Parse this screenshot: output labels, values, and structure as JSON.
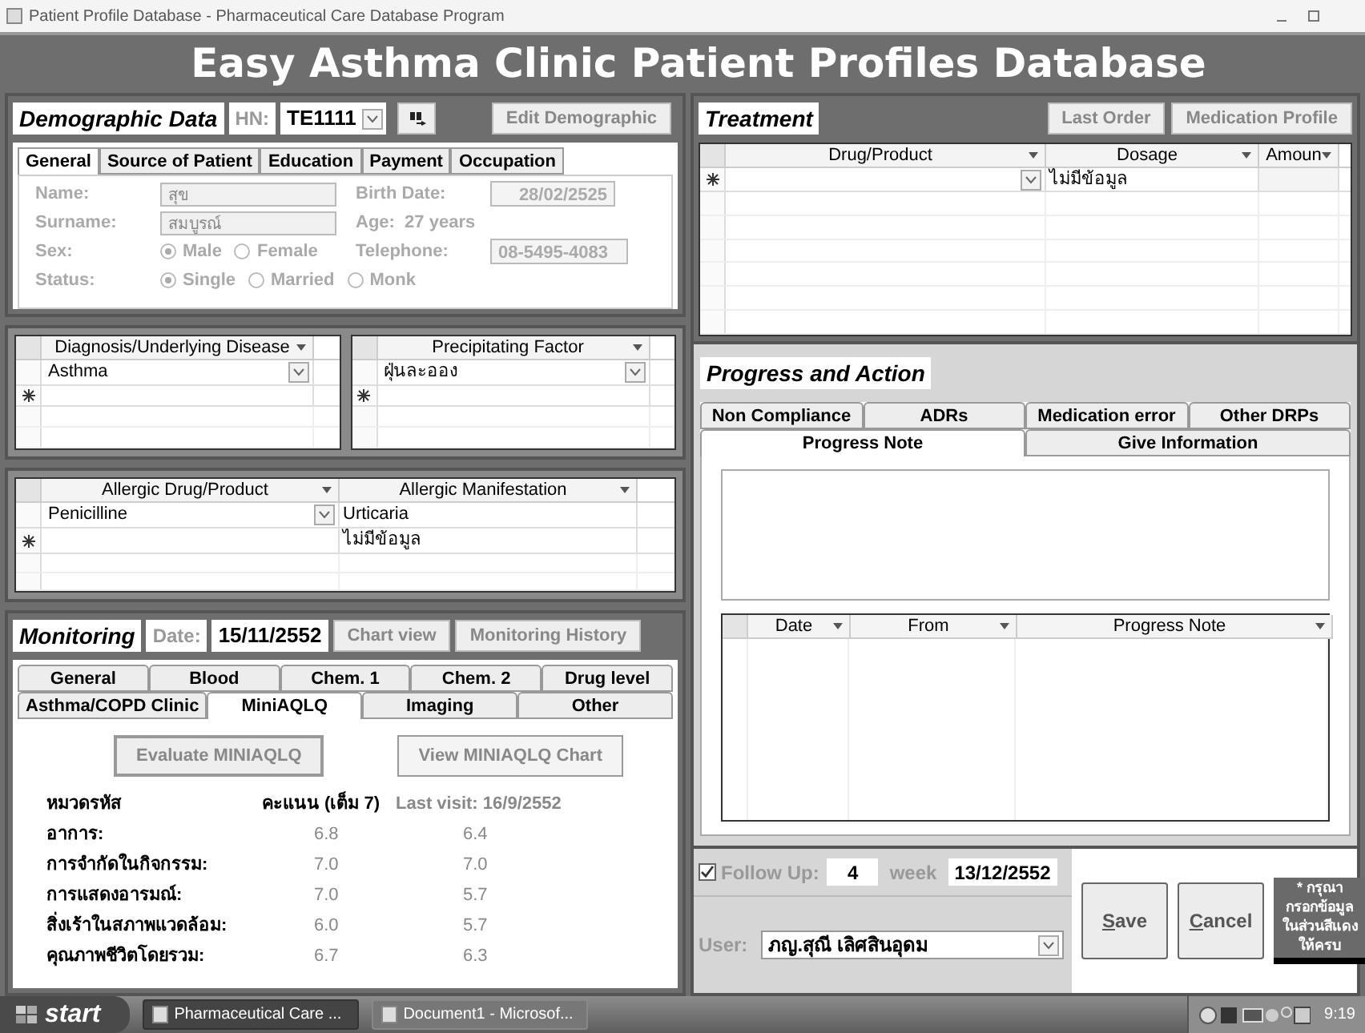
{
  "window": {
    "title": "Patient Profile Database - Pharmaceutical Care Database Program"
  },
  "header": {
    "title": "Easy Asthma Clinic Patient Profiles Database"
  },
  "demographic": {
    "title": "Demographic Data",
    "hn_label": "HN:",
    "hn_value": "TE1111",
    "edit_button": "Edit Demographic",
    "tabs": [
      {
        "label": "General",
        "selected": true
      },
      {
        "label": "Source of Patient",
        "selected": false
      },
      {
        "label": "Education",
        "selected": false
      },
      {
        "label": "Payment",
        "selected": false
      },
      {
        "label": "Occupation",
        "selected": false
      }
    ],
    "name_label": "Name:",
    "name_value": "สุข",
    "surname_label": "Surname:",
    "surname_value": "สมบูรณ์",
    "birth_label": "Birth Date:",
    "birth_value": "28/02/2525",
    "age": "Age:  27 years",
    "sex_label": "Sex:",
    "telephone_label": "Telephone:",
    "telephone_value": "08-5495-4083",
    "status_label": "Status:",
    "sex_options": [
      {
        "label": "Male",
        "selected": true
      },
      {
        "label": "Female",
        "selected": false
      }
    ],
    "status_options": [
      {
        "label": "Single",
        "selected": true
      },
      {
        "label": "Married",
        "selected": false
      },
      {
        "label": "Monk",
        "selected": false
      }
    ]
  },
  "diagnosis_grid": {
    "column": "Diagnosis/Underlying Disease",
    "value": "Asthma"
  },
  "precipitating_grid": {
    "column": "Precipitating Factor",
    "value": "ฝุ่นละออง"
  },
  "allergy_grid": {
    "columns": [
      "Allergic Drug/Product",
      "Allergic Manifestation"
    ],
    "row": [
      "Penicilline",
      "Urticaria"
    ],
    "new_row_manifestation": "ไม่มีข้อมูล"
  },
  "monitoring": {
    "title": "Monitoring",
    "date_label": "Date:",
    "date_value": "15/11/2552",
    "buttons": [
      "Chart view",
      "Monitoring History"
    ],
    "tab_rows": [
      [
        {
          "label": "General",
          "selected": false
        },
        {
          "label": "Blood",
          "selected": false
        },
        {
          "label": "Chem. 1",
          "selected": false
        },
        {
          "label": "Chem. 2",
          "selected": false
        },
        {
          "label": "Drug level",
          "selected": false
        }
      ],
      [
        {
          "label": "Asthma/COPD Clinic",
          "selected": false
        },
        {
          "label": "MiniAQLQ",
          "selected": true
        },
        {
          "label": "Imaging",
          "selected": false
        },
        {
          "label": "Other",
          "selected": false
        }
      ]
    ],
    "evaluate_button": "Evaluate MINIAQLQ",
    "chart_button": "View MINIAQLQ Chart",
    "columns": [
      "หมวดรหัส",
      "คะแนน (เต็ม 7)",
      "Last visit: 16/9/2552"
    ],
    "rows": [
      [
        "อาการ:",
        "6.8",
        "6.4"
      ],
      [
        "การจำกัดในกิจกรรม:",
        "7.0",
        "7.0"
      ],
      [
        "การแสดงอารมณ์:",
        "7.0",
        "5.7"
      ],
      [
        "สิ่งเร้าในสภาพแวดล้อม:",
        "6.0",
        "5.7"
      ],
      [
        "คุณภาพชีวิตโดยรวม:",
        "6.7",
        "6.3"
      ]
    ]
  },
  "treatment": {
    "title": "Treatment",
    "buttons": [
      "Last Order",
      "Medication Profile"
    ],
    "columns": [
      "Drug/Product",
      "Dosage",
      "Amoun"
    ],
    "new_row_dosage": "ไม่มีข้อมูล"
  },
  "progress": {
    "title": "Progress and Action",
    "tab_rows": [
      [
        {
          "label": "Non Compliance",
          "selected": false
        },
        {
          "label": "ADRs",
          "selected": false
        },
        {
          "label": "Medication error",
          "selected": false
        },
        {
          "label": "Other DRPs",
          "selected": false
        }
      ],
      [
        {
          "label": "Progress Note",
          "selected": true
        },
        {
          "label": "Give Information",
          "selected": false
        }
      ]
    ],
    "columns": [
      "Date",
      "From",
      "Progress Note"
    ]
  },
  "footer": {
    "follow_up_checked": true,
    "follow_up_label": "Follow Up:",
    "weeks": "4",
    "week_label": "week",
    "follow_up_date": "13/12/2552",
    "user_label": "User:",
    "user_value": "ภญ.สุณี เลิศสินอุดม",
    "save_button": "Save",
    "cancel_button": "Cancel",
    "note": "* กรุณา\nกรอกข้อมูล\nในส่วนสีแดง\nให้ครบ"
  },
  "taskbar": {
    "start": "start",
    "tasks": [
      {
        "label": "Pharmaceutical Care ...",
        "selected": true
      },
      {
        "label": "Document1 - Microsof...",
        "selected": false
      }
    ],
    "time": "9:19"
  }
}
